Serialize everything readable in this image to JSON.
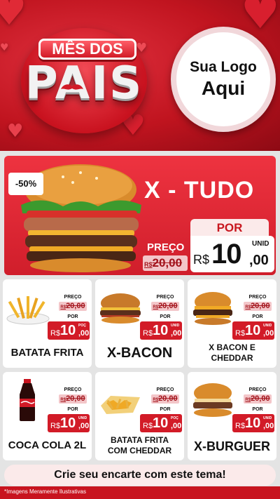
{
  "header": {
    "badge_top": "MÊS DOS",
    "badge_main": "PAIS",
    "logo_line1": "Sua Logo",
    "logo_line2": "Aqui",
    "colors": {
      "primary": "#d21b27",
      "background_dark": "#8d0a14"
    }
  },
  "featured": {
    "discount": "-50%",
    "name": "X - TUDO",
    "por_label": "POR",
    "preco_label": "PREÇO",
    "old_currency": "R$",
    "old_price": "20,00",
    "currency": "R$",
    "price_int": "10",
    "price_dec": ",00",
    "unit": "UNID",
    "image_icon": "burger-icon"
  },
  "products": [
    {
      "name": "BATATA FRITA",
      "preco_label": "PREÇO",
      "old_currency": "R$",
      "old_price": "20,00",
      "por_label": "POR",
      "currency": "R$",
      "price_int": "10",
      "price_dec": ",00",
      "unit": "POÇ",
      "image_icon": "fries-icon"
    },
    {
      "name": "X-BACON",
      "preco_label": "PREÇO",
      "old_currency": "R$",
      "old_price": "20,00",
      "por_label": "POR",
      "currency": "R$",
      "price_int": "10",
      "price_dec": ",00",
      "unit": "UNID",
      "image_icon": "burger-icon"
    },
    {
      "name": "X BACON E CHEDDAR",
      "preco_label": "PREÇO",
      "old_currency": "R$",
      "old_price": "20,00",
      "por_label": "POR",
      "currency": "R$",
      "price_int": "10",
      "price_dec": ",00",
      "unit": "UNID",
      "image_icon": "burger-icon"
    },
    {
      "name": "COCA COLA 2L",
      "preco_label": "PREÇO",
      "old_currency": "R$",
      "old_price": "20,00",
      "por_label": "POR",
      "currency": "R$",
      "price_int": "10",
      "price_dec": ",00",
      "unit": "UNID",
      "image_icon": "soda-bottle-icon"
    },
    {
      "name": "BATATA FRITA COM CHEDDAR",
      "preco_label": "PREÇO",
      "old_currency": "R$",
      "old_price": "20,00",
      "por_label": "POR",
      "currency": "R$",
      "price_int": "10",
      "price_dec": ",00",
      "unit": "POÇ",
      "image_icon": "fries-cheddar-icon"
    },
    {
      "name": "X-BURGUER",
      "preco_label": "PREÇO",
      "old_currency": "R$",
      "old_price": "20,00",
      "por_label": "POR",
      "currency": "R$",
      "price_int": "10",
      "price_dec": ",00",
      "unit": "UNID",
      "image_icon": "burger-icon"
    }
  ],
  "cta": "Crie seu encarte com este tema!",
  "footnote": "*Imagens Meramente Ilustrativas"
}
